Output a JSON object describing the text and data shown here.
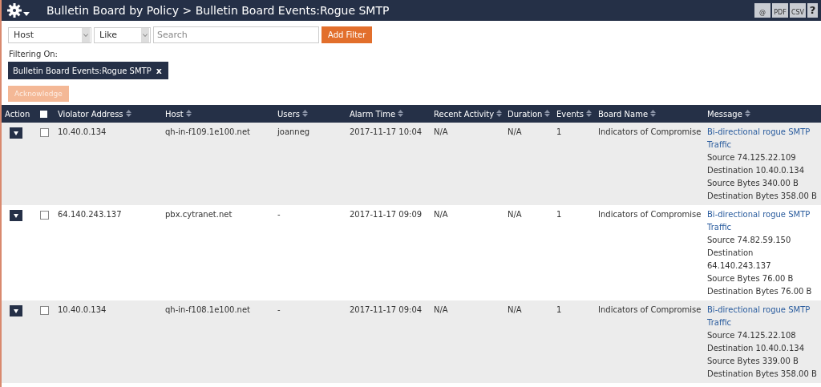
{
  "header": {
    "title": "Bulletin Board by Policy > Bulletin Board Events:Rogue SMTP",
    "exports": [
      "@",
      "PDF",
      "CSV"
    ],
    "help": "?"
  },
  "filter": {
    "field": "Host",
    "operator": "Like",
    "placeholder": "Search",
    "add_button": "Add Filter"
  },
  "filtering_on": {
    "label": "Filtering On:",
    "chips": [
      {
        "text": "Bulletin Board Events:Rogue SMTP",
        "remove": "x"
      }
    ]
  },
  "acknowledge": {
    "label": "Acknowledge",
    "disabled": true
  },
  "table": {
    "select_all": {
      "checked": false
    },
    "columns": [
      "Action",
      "Violator Address",
      "Host",
      "Users",
      "Alarm Time",
      "Recent Activity",
      "Duration",
      "Events",
      "Board Name",
      "Message"
    ],
    "rows": [
      {
        "checked": false,
        "violator": "10.40.0.134",
        "host": "qh-in-f109.1e100.net",
        "users": "joanneg",
        "alarm_time": "2017-11-17 10:04",
        "recent_activity": "N/A",
        "duration": "N/A",
        "events": "1",
        "board_name": "Indicators of Compromise",
        "message": [
          "Bi-directional rogue SMTP Traffic",
          "Source 74.125.22.109",
          "Destination 10.40.0.134",
          "Source Bytes 340.00 B",
          "Destination Bytes 358.00 B"
        ]
      },
      {
        "checked": false,
        "violator": "64.140.243.137",
        "host": "pbx.cytranet.net",
        "users": "-",
        "alarm_time": "2017-11-17 09:09",
        "recent_activity": "N/A",
        "duration": "N/A",
        "events": "1",
        "board_name": "Indicators of Compromise",
        "message": [
          "Bi-directional rogue SMTP Traffic",
          "Source 74.82.59.150",
          "Destination 64.140.243.137",
          "Source Bytes 76.00 B",
          "Destination Bytes 76.00 B"
        ]
      },
      {
        "checked": false,
        "violator": "10.40.0.134",
        "host": "qh-in-f108.1e100.net",
        "users": "-",
        "alarm_time": "2017-11-17 09:04",
        "recent_activity": "N/A",
        "duration": "N/A",
        "events": "1",
        "board_name": "Indicators of Compromise",
        "message": [
          "Bi-directional rogue SMTP Traffic",
          "Source 74.125.22.108",
          "Destination 10.40.0.134",
          "Source Bytes 339.00 B",
          "Destination Bytes 358.00 B"
        ]
      }
    ]
  }
}
